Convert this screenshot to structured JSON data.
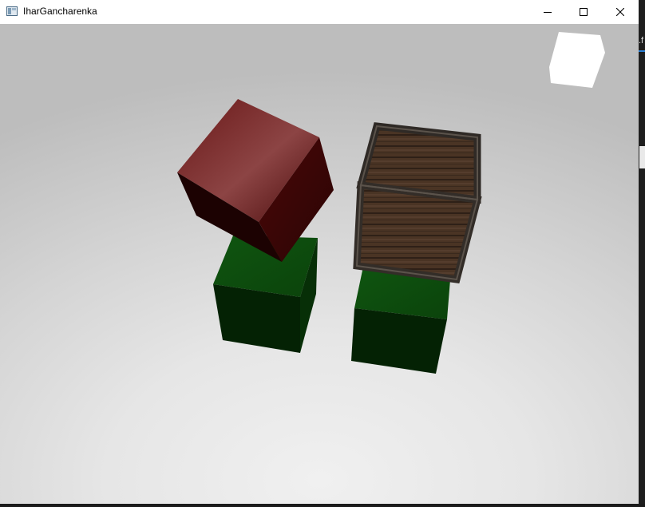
{
  "window": {
    "title": "IharGancharenka",
    "minimize_icon": "minimize-icon",
    "maximize_icon": "maximize-icon",
    "close_icon": "close-icon"
  },
  "background_app": {
    "visible_text": ".f"
  },
  "scene": {
    "objects": [
      {
        "name": "red-cube",
        "color": "#5a1010"
      },
      {
        "name": "wooden-crate",
        "color": "#4a3525"
      },
      {
        "name": "green-cube-left",
        "color": "#0c4a0c"
      },
      {
        "name": "green-cube-right",
        "color": "#0c4a0c"
      },
      {
        "name": "light-cube",
        "color": "#ffffff"
      }
    ]
  }
}
